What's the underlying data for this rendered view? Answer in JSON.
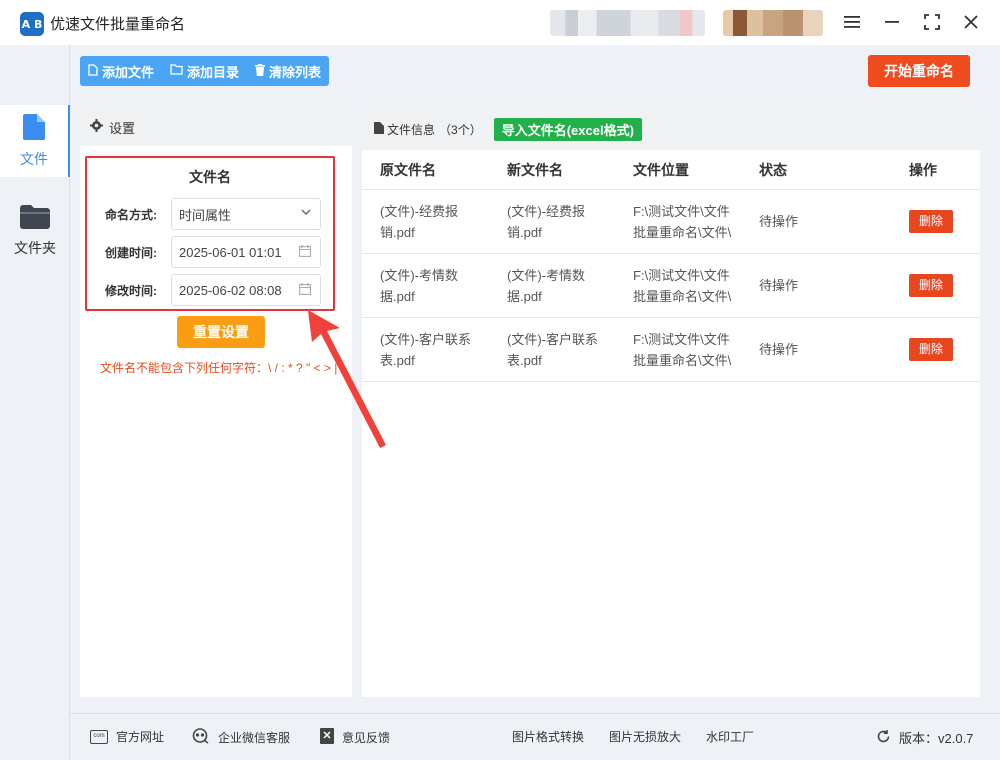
{
  "titlebar": {
    "logo_text": "A B",
    "title": "优速文件批量重命名"
  },
  "leftnav": {
    "items": [
      {
        "label": "文件",
        "icon": "file-icon",
        "active": true
      },
      {
        "label": "文件夹",
        "icon": "folder-icon",
        "active": false
      }
    ]
  },
  "toolbar": {
    "add_file": "添加文件",
    "add_dir": "添加目录",
    "clear_list": "清除列表",
    "start": "开始重命名"
  },
  "settings": {
    "header": "设置",
    "section_title": "文件名",
    "naming_label": "命名方式:",
    "naming_value": "时间属性",
    "created_label": "创建时间:",
    "created_value": "2025-06-01 01:01",
    "modified_label": "修改时间:",
    "modified_value": "2025-06-02 08:08",
    "reset_button": "重置设置",
    "warning": "文件名不能包含下列任何字符：\\ / : * ? \" < > |"
  },
  "fileinfo": {
    "header": "文件信息",
    "count": "（3个）",
    "import_button": "导入文件名(excel格式)",
    "columns": [
      "原文件名",
      "新文件名",
      "文件位置",
      "状态",
      "操作"
    ],
    "rows": [
      {
        "orig": "(文件)-经费报销.pdf",
        "new": "(文件)-经费报销.pdf",
        "loc": "F:\\测试文件\\文件批量重命名\\文件\\",
        "status": "待操作",
        "action": "删除"
      },
      {
        "orig": "(文件)-考情数据.pdf",
        "new": "(文件)-考情数据.pdf",
        "loc": "F:\\测试文件\\文件批量重命名\\文件\\",
        "status": "待操作",
        "action": "删除"
      },
      {
        "orig": "(文件)-客户联系表.pdf",
        "new": "(文件)-客户联系表.pdf",
        "loc": "F:\\测试文件\\文件批量重命名\\文件\\",
        "status": "待操作",
        "action": "删除"
      }
    ]
  },
  "footer": {
    "website": "官方网址",
    "wechat": "企业微信客服",
    "feedback": "意见反馈",
    "img_convert": "图片格式转换",
    "img_enlarge": "图片无损放大",
    "watermark": "水印工厂",
    "version": "版本：v2.0.7"
  },
  "colors": {
    "accent_blue": "#3b8df0",
    "toolbar_blue": "#4aa6f4",
    "start_red": "#f04a1f",
    "reset_orange": "#fa9d12",
    "import_green": "#22b04b",
    "highlight_red": "#e8333b"
  }
}
